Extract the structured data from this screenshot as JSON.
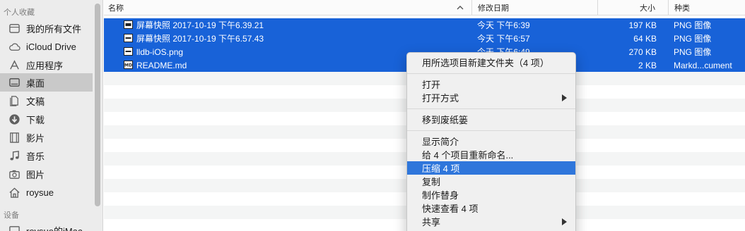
{
  "sidebar": {
    "favorites_heading": "个人收藏",
    "devices_heading": "设备",
    "items": [
      {
        "label": "我的所有文件",
        "icon": "all-files-icon"
      },
      {
        "label": "iCloud Drive",
        "icon": "cloud-icon"
      },
      {
        "label": "应用程序",
        "icon": "applications-icon"
      },
      {
        "label": "桌面",
        "icon": "desktop-icon",
        "active": true
      },
      {
        "label": "文稿",
        "icon": "documents-icon"
      },
      {
        "label": "下载",
        "icon": "download-icon"
      },
      {
        "label": "影片",
        "icon": "film-icon"
      },
      {
        "label": "音乐",
        "icon": "music-icon"
      },
      {
        "label": "图片",
        "icon": "camera-icon"
      },
      {
        "label": "roysue",
        "icon": "home-icon"
      }
    ],
    "devices": [
      {
        "label": "roysue的iMac",
        "icon": "imac-icon"
      }
    ]
  },
  "columns": {
    "name": "名称",
    "date": "修改日期",
    "size": "大小",
    "kind": "种类"
  },
  "files": [
    {
      "name": "屏幕快照 2017-10-19 下午6.39.21",
      "date": "今天 下午6:39",
      "size": "197 KB",
      "kind": "PNG 图像",
      "icon": "screenshot-file-icon"
    },
    {
      "name": "屏幕快照 2017-10-19 下午6.57.43",
      "date": "今天 下午6:57",
      "size": "64 KB",
      "kind": "PNG 图像",
      "icon": "screenshot-file-icon"
    },
    {
      "name": "lldb-iOS.png",
      "date": "今天 下午6:49",
      "size": "270 KB",
      "kind": "PNG 图像",
      "icon": "png-file-icon"
    },
    {
      "name": "README.md",
      "date": "",
      "size": "2 KB",
      "kind": "Markd...cument",
      "icon": "markdown-file-icon"
    }
  ],
  "context_menu": {
    "groups": [
      [
        "用所选项目新建文件夹（4 项）"
      ],
      [
        "打开",
        "打开方式"
      ],
      [
        "移到废纸篓"
      ],
      [
        "显示简介",
        "给 4 个项目重新命名...",
        "压缩 4 项",
        "复制",
        "制作替身",
        "快速查看 4 项",
        "共享"
      ]
    ],
    "highlighted": "压缩 4 项",
    "submenu_items": [
      "打开方式",
      "共享"
    ]
  },
  "colors": {
    "selection": "#1862d8",
    "menu_highlight": "#2f76db",
    "sidebar_bg": "#ececec"
  }
}
